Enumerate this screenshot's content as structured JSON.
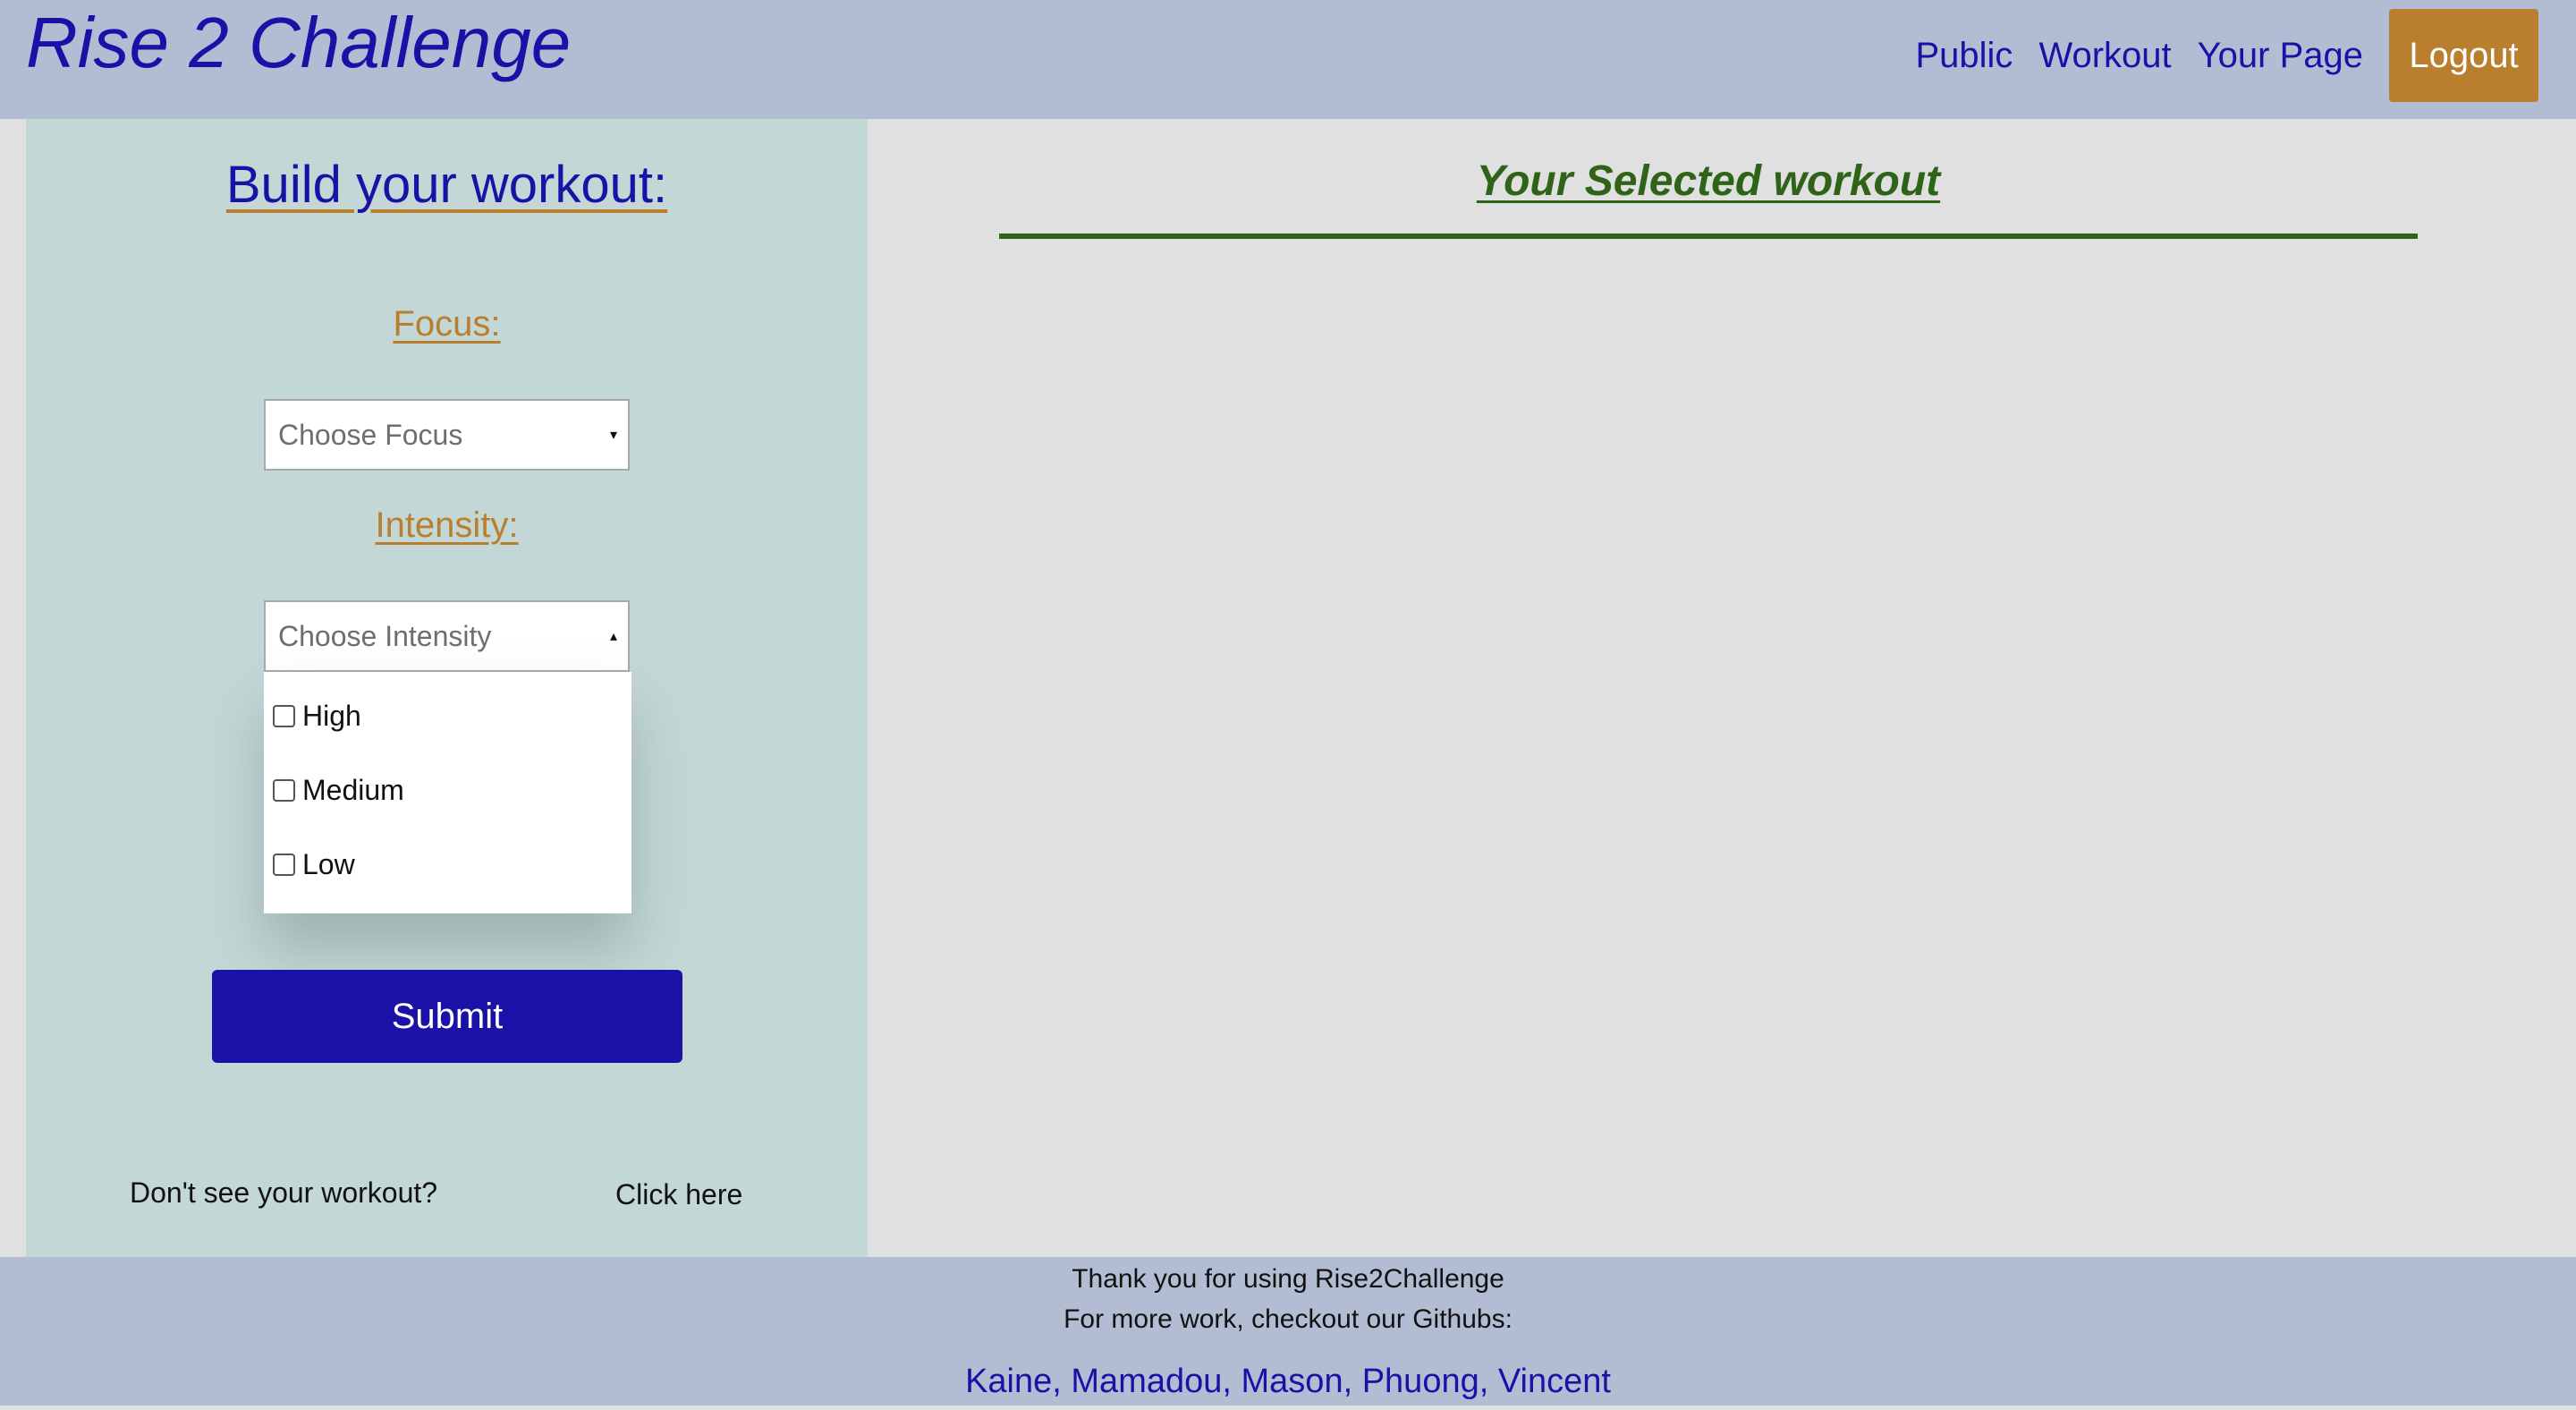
{
  "header": {
    "brand": "Rise 2 Challenge",
    "nav": [
      "Public",
      "Workout",
      "Your Page"
    ],
    "logout": "Logout"
  },
  "builder": {
    "title": "Build your workout:",
    "focus_label": "Focus:",
    "focus_placeholder": "Choose Focus",
    "focus_arrow": "▾",
    "intensity_label": "Intensity:",
    "intensity_placeholder": "Choose Intensity",
    "intensity_arrow": "▴",
    "intensity_options": [
      "High",
      "Medium",
      "Low"
    ],
    "submit": "Submit",
    "missing_text": "Don't see your workout?",
    "click_here": "Click here"
  },
  "selected": {
    "title": "Your Selected workout"
  },
  "footer": {
    "thanks": "Thank you for using Rise2Challenge",
    "more": "For more work, checkout our Githubs:",
    "githubs": [
      "Kaine",
      "Mamadou",
      "Mason",
      "Phuong",
      "Vincent"
    ]
  },
  "colors": {
    "header_bg": "#b2bdd3",
    "primary": "#1a12a6",
    "accent": "#b97f2e",
    "builder_bg": "#c3d7d6",
    "selected_green": "#2e6318"
  }
}
